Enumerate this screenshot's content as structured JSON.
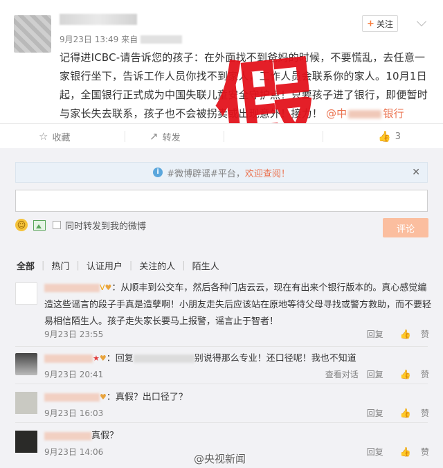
{
  "post": {
    "time_source": "9月23日 13:49 来自",
    "follow_label": "关注",
    "text_main": "记得进ICBC-请告诉您的孩子：在外面找不到爸妈的时候，不要慌乱，去任意一家银行坐下，告诉工作人员你找不到家人，工作人员会联系你的家人。10月1日起，全国银行正式成为中国失联儿童安全守护点！只要孩子进了银行，即便暂时与家长失去联系，孩子也不会被拐卖或出现意外！接力！",
    "mention_prefix": "@中",
    "mention_suffix": "银行",
    "stamp": "假"
  },
  "actions": {
    "favorite": "收藏",
    "repost": "转发",
    "like_count": "3"
  },
  "comment_box": {
    "notice_prefix": "#微博辟谣#平台，",
    "notice_link": "欢迎查阅！",
    "also_repost": "同时转发到我的微博",
    "submit": "评论"
  },
  "filters": [
    "全部",
    "热门",
    "认证用户",
    "关注的人",
    "陌生人"
  ],
  "comments": [
    {
      "text": "：从顺丰到公交车，然后各种门店云云，现在有出来个银行版本的。真心感觉编造这些谣言的段子手真是造孽啊！小朋友走失后应该站在原地等待父母寻找或警方救助，而不要轻易相信陌生人。孩子走失家长要马上报警，谣言止于智者！",
      "time": "9月23日 23:55",
      "reply": "回复"
    },
    {
      "text": "：回复",
      "text_tail": "别说得那么专业！还口径呢！我也不知道",
      "time": "9月23日 20:41",
      "view_thread": "查看对话",
      "reply": "回复"
    },
    {
      "text": "：真假？出口径了？",
      "time": "9月23日 16:03",
      "reply": "回复"
    },
    {
      "text": "真假？",
      "time": "9月23日 14:06",
      "reply": "回复"
    }
  ],
  "like_label": "赞",
  "watermark": "@央视新闻",
  "colors": {
    "accent": "#eb7350",
    "stamp_red": "#e3121b",
    "notice_bg": "#eaf1f8",
    "submit_bg": "#fbbe9f"
  }
}
